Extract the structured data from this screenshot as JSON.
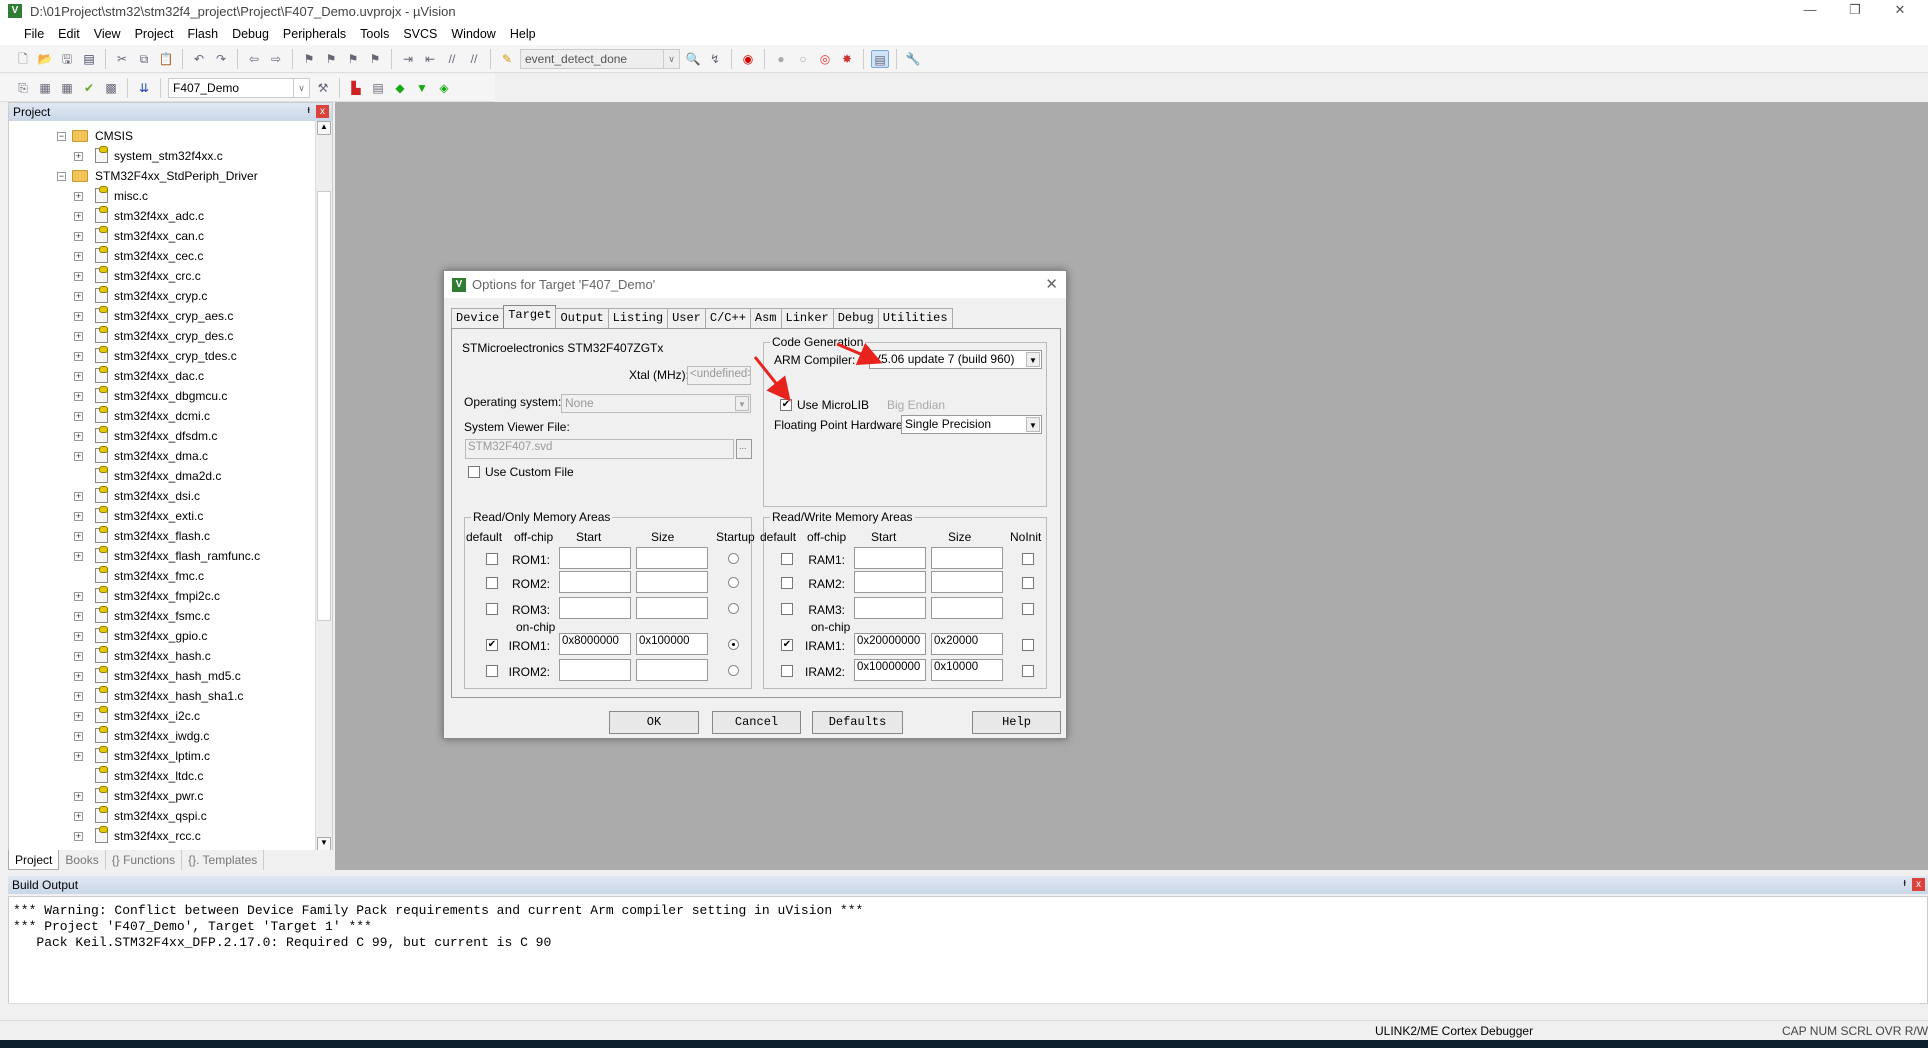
{
  "window": {
    "title": "D:\\01Project\\stm32\\stm32f4_project\\Project\\F407_Demo.uvprojx - µVision",
    "min": "—",
    "max": "❐",
    "close": "✕"
  },
  "menu": [
    "File",
    "Edit",
    "View",
    "Project",
    "Flash",
    "Debug",
    "Peripherals",
    "Tools",
    "SVCS",
    "Window",
    "Help"
  ],
  "toolbar": {
    "find_combo": "event_detect_done",
    "target_combo": "F407_Demo"
  },
  "project_panel": {
    "title": "Project",
    "pin": "ᵻ",
    "close": "x",
    "tree": [
      {
        "label": "CMSIS",
        "type": "folder"
      },
      {
        "label": "system_stm32f4xx.c",
        "type": "file",
        "exp": true
      },
      {
        "label": "STM32F4xx_StdPeriph_Driver",
        "type": "folder"
      },
      {
        "label": "misc.c",
        "type": "file",
        "exp": true
      },
      {
        "label": "stm32f4xx_adc.c",
        "type": "file",
        "exp": true
      },
      {
        "label": "stm32f4xx_can.c",
        "type": "file",
        "exp": true
      },
      {
        "label": "stm32f4xx_cec.c",
        "type": "file",
        "exp": true
      },
      {
        "label": "stm32f4xx_crc.c",
        "type": "file",
        "exp": true
      },
      {
        "label": "stm32f4xx_cryp.c",
        "type": "file",
        "exp": true
      },
      {
        "label": "stm32f4xx_cryp_aes.c",
        "type": "file",
        "exp": true
      },
      {
        "label": "stm32f4xx_cryp_des.c",
        "type": "file",
        "exp": true
      },
      {
        "label": "stm32f4xx_cryp_tdes.c",
        "type": "file",
        "exp": true
      },
      {
        "label": "stm32f4xx_dac.c",
        "type": "file",
        "exp": true
      },
      {
        "label": "stm32f4xx_dbgmcu.c",
        "type": "file",
        "exp": true
      },
      {
        "label": "stm32f4xx_dcmi.c",
        "type": "file",
        "exp": true
      },
      {
        "label": "stm32f4xx_dfsdm.c",
        "type": "file",
        "exp": true
      },
      {
        "label": "stm32f4xx_dma.c",
        "type": "file",
        "exp": true
      },
      {
        "label": "stm32f4xx_dma2d.c",
        "type": "file",
        "exp": false
      },
      {
        "label": "stm32f4xx_dsi.c",
        "type": "file",
        "exp": true
      },
      {
        "label": "stm32f4xx_exti.c",
        "type": "file",
        "exp": true
      },
      {
        "label": "stm32f4xx_flash.c",
        "type": "file",
        "exp": true
      },
      {
        "label": "stm32f4xx_flash_ramfunc.c",
        "type": "file",
        "exp": true
      },
      {
        "label": "stm32f4xx_fmc.c",
        "type": "file",
        "exp": false
      },
      {
        "label": "stm32f4xx_fmpi2c.c",
        "type": "file",
        "exp": true
      },
      {
        "label": "stm32f4xx_fsmc.c",
        "type": "file",
        "exp": true
      },
      {
        "label": "stm32f4xx_gpio.c",
        "type": "file",
        "exp": true
      },
      {
        "label": "stm32f4xx_hash.c",
        "type": "file",
        "exp": true
      },
      {
        "label": "stm32f4xx_hash_md5.c",
        "type": "file",
        "exp": true
      },
      {
        "label": "stm32f4xx_hash_sha1.c",
        "type": "file",
        "exp": true
      },
      {
        "label": "stm32f4xx_i2c.c",
        "type": "file",
        "exp": true
      },
      {
        "label": "stm32f4xx_iwdg.c",
        "type": "file",
        "exp": true
      },
      {
        "label": "stm32f4xx_lptim.c",
        "type": "file",
        "exp": true
      },
      {
        "label": "stm32f4xx_ltdc.c",
        "type": "file",
        "exp": false
      },
      {
        "label": "stm32f4xx_pwr.c",
        "type": "file",
        "exp": true
      },
      {
        "label": "stm32f4xx_qspi.c",
        "type": "file",
        "exp": true
      },
      {
        "label": "stm32f4xx_rcc.c",
        "type": "file",
        "exp": true
      }
    ],
    "tabs": [
      "Project",
      "Books",
      "{} Functions",
      "{}. Templates"
    ]
  },
  "build_output": {
    "title": "Build Output",
    "lines": [
      "*** Warning: Conflict between Device Family Pack requirements and current Arm compiler setting in uVision ***",
      "*** Project 'F407_Demo', Target 'Target 1' ***",
      "   Pack Keil.STM32F4xx_DFP.2.17.0: Required C 99, but current is C 90"
    ]
  },
  "status": {
    "debugger": "ULINK2/ME Cortex Debugger",
    "indicators": "CAP NUM SCRL OVR R/W"
  },
  "dialog": {
    "title": "Options for Target 'F407_Demo'",
    "close": "✕",
    "tabs": [
      "Device",
      "Target",
      "Output",
      "Listing",
      "User",
      "C/C++",
      "Asm",
      "Linker",
      "Debug",
      "Utilities"
    ],
    "active_tab": "Target",
    "device": "STMicroelectronics STM32F407ZGTx",
    "xtal_label": "Xtal (MHz):",
    "xtal_value": "<undefined>",
    "os_label": "Operating system:",
    "os_value": "None",
    "svf_label": "System Viewer File:",
    "svf_value": "STM32F407.svd",
    "browse": "...",
    "custom_file": "Use Custom File",
    "codegen": {
      "title": "Code Generation",
      "compiler_label": "ARM Compiler:",
      "compiler_value": "V5.06 update 7 (build 960)",
      "microlib": "Use MicroLIB",
      "microlib_checked": true,
      "big_endian": "Big Endian",
      "fpu_label": "Floating Point Hardware:",
      "fpu_value": "Single Precision"
    },
    "rom": {
      "title": "Read/Only Memory Areas",
      "headers": [
        "default",
        "off-chip",
        "Start",
        "Size",
        "Startup"
      ],
      "onchip": "on-chip",
      "rows": [
        {
          "name": "ROM1:",
          "default": false,
          "start": "",
          "size": "",
          "startup": false
        },
        {
          "name": "ROM2:",
          "default": false,
          "start": "",
          "size": "",
          "startup": false
        },
        {
          "name": "ROM3:",
          "default": false,
          "start": "",
          "size": "",
          "startup": false
        },
        {
          "name": "IROM1:",
          "default": true,
          "start": "0x8000000",
          "size": "0x100000",
          "startup": true
        },
        {
          "name": "IROM2:",
          "default": false,
          "start": "",
          "size": "",
          "startup": false
        }
      ]
    },
    "ram": {
      "title": "Read/Write Memory Areas",
      "headers": [
        "default",
        "off-chip",
        "Start",
        "Size",
        "NoInit"
      ],
      "onchip": "on-chip",
      "rows": [
        {
          "name": "RAM1:",
          "default": false,
          "start": "",
          "size": "",
          "noinit": false
        },
        {
          "name": "RAM2:",
          "default": false,
          "start": "",
          "size": "",
          "noinit": false
        },
        {
          "name": "RAM3:",
          "default": false,
          "start": "",
          "size": "",
          "noinit": false
        },
        {
          "name": "IRAM1:",
          "default": true,
          "start": "0x20000000",
          "size": "0x20000",
          "noinit": false
        },
        {
          "name": "IRAM2:",
          "default": false,
          "start": "0x10000000",
          "size": "0x10000",
          "noinit": false
        }
      ]
    },
    "buttons": {
      "ok": "OK",
      "cancel": "Cancel",
      "defaults": "Defaults",
      "help": "Help"
    },
    "annotation_color": "#e8231e"
  }
}
